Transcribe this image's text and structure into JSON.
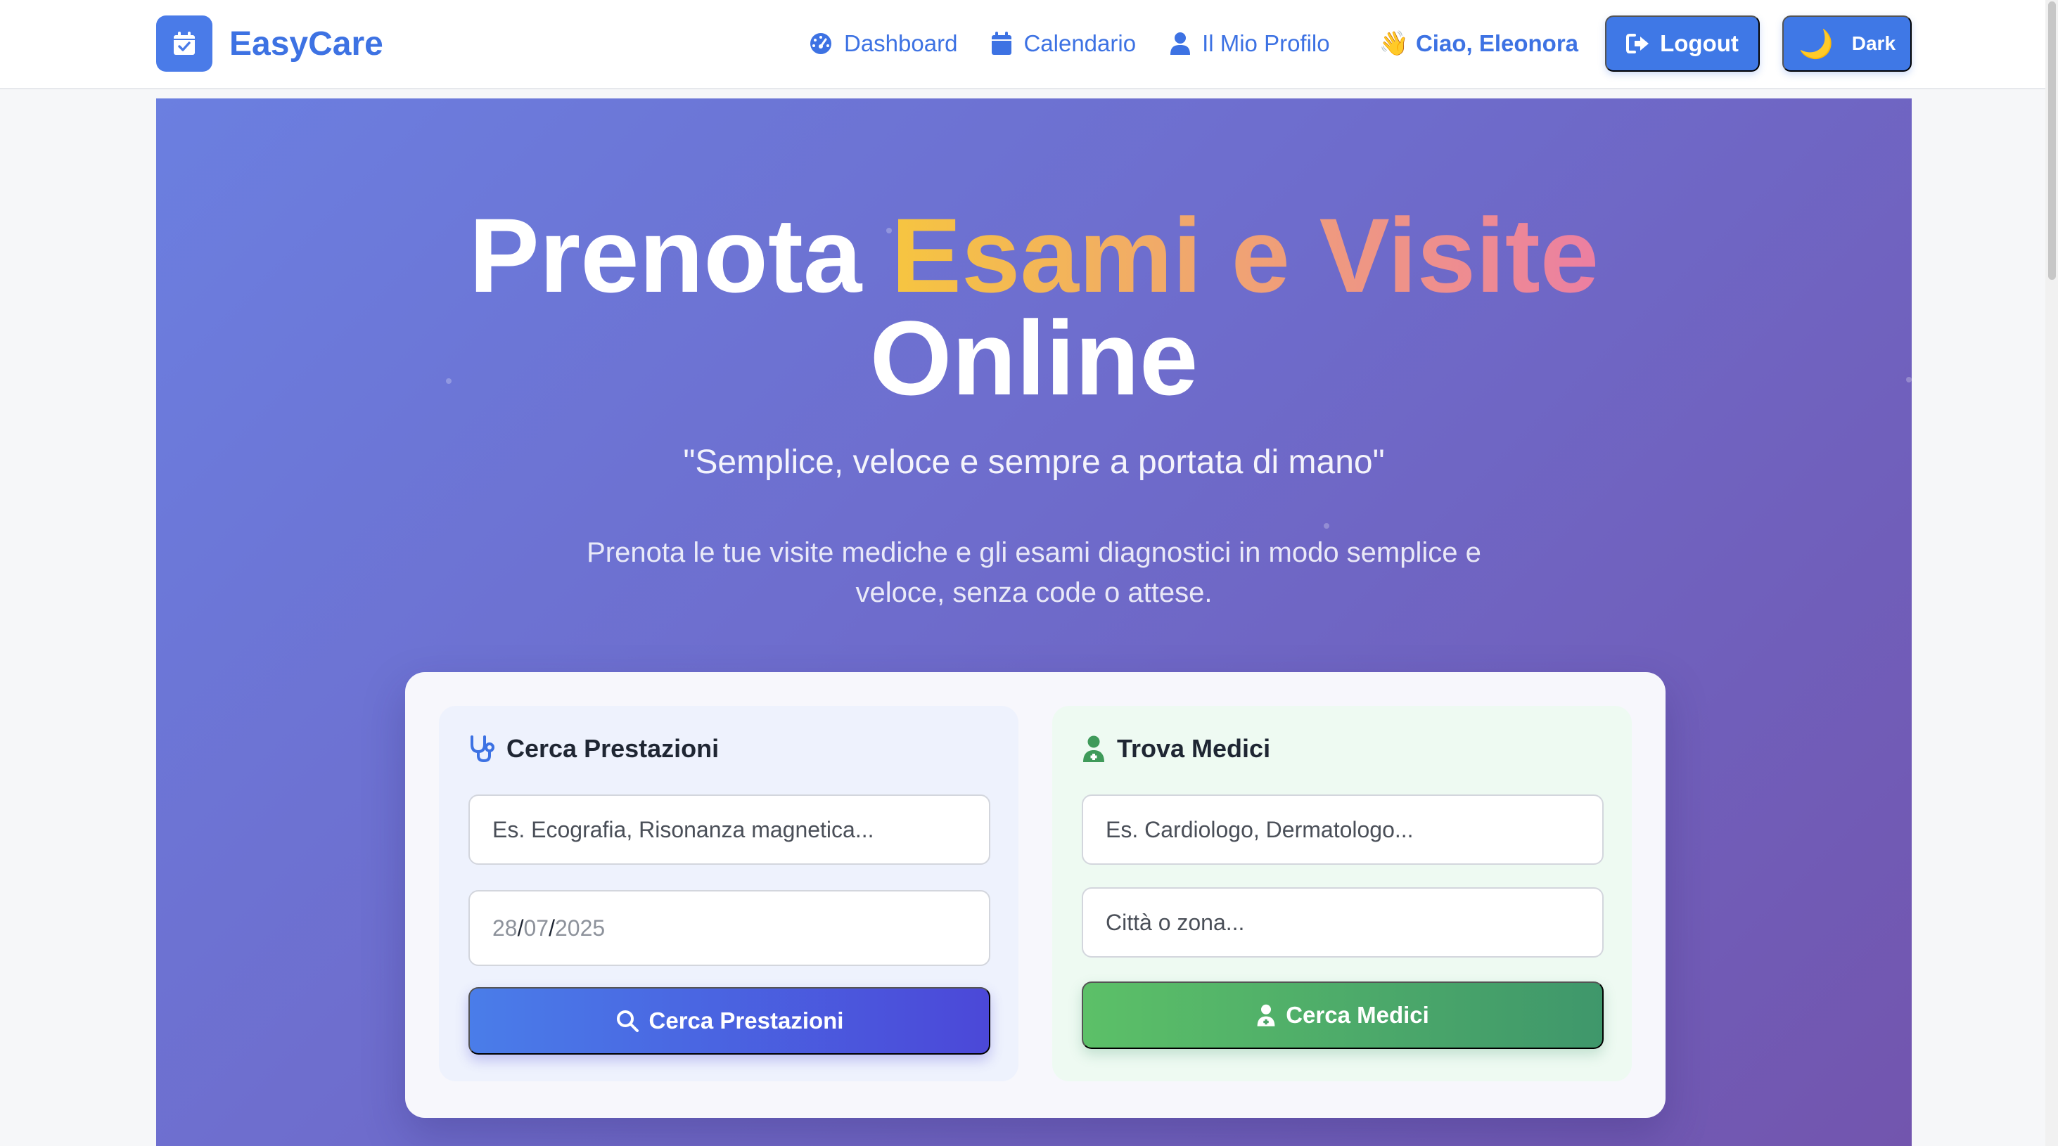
{
  "navbar": {
    "brand_name": "EasyCare",
    "links": {
      "dashboard": "Dashboard",
      "calendar": "Calendario",
      "profile": "Il Mio Profilo"
    },
    "greeting": "Ciao, Eleonora",
    "greeting_icon": "👋",
    "logout_label": "Logout",
    "theme_icon": "🌙",
    "theme_label": "Dark"
  },
  "hero": {
    "title_part1": "Prenota ",
    "title_highlight": "Esami e Visite",
    "title_part2": "Online",
    "quote": "\"Semplice, veloce e sempre a portata di mano\"",
    "description": "Prenota le tue visite mediche e gli esami diagnostici in modo semplice e veloce, senza code o attese."
  },
  "search_services": {
    "heading": "Cerca Prestazioni",
    "query_placeholder": "Es. Ecografia, Risonanza magnetica...",
    "date": {
      "day": "28",
      "month": "07",
      "year": "2025"
    },
    "button_label": "Cerca Prestazioni"
  },
  "search_doctors": {
    "heading": "Trova Medici",
    "specialty_placeholder": "Es. Cardiologo, Dermatologo...",
    "location_placeholder": "Città o zona...",
    "button_label": "Cerca Medici"
  },
  "icons": {
    "brand": "calendar-check-icon",
    "dashboard": "gauge-icon",
    "calendar": "calendar-icon",
    "profile": "user-icon",
    "logout": "sign-out-icon",
    "services": "stethoscope-icon",
    "doctors": "user-doctor-icon",
    "search": "search-icon"
  },
  "colors": {
    "primary": "#3d72e3",
    "hero_start": "#6b7fe0",
    "hero_end": "#7255ae",
    "highlight_start": "#f6c540",
    "highlight_end": "#ec7fa2",
    "search_button_start": "#4a7de9",
    "search_button_end": "#4b48d8",
    "doctor_button_start": "#5cc068",
    "doctor_button_end": "#3f976b"
  }
}
